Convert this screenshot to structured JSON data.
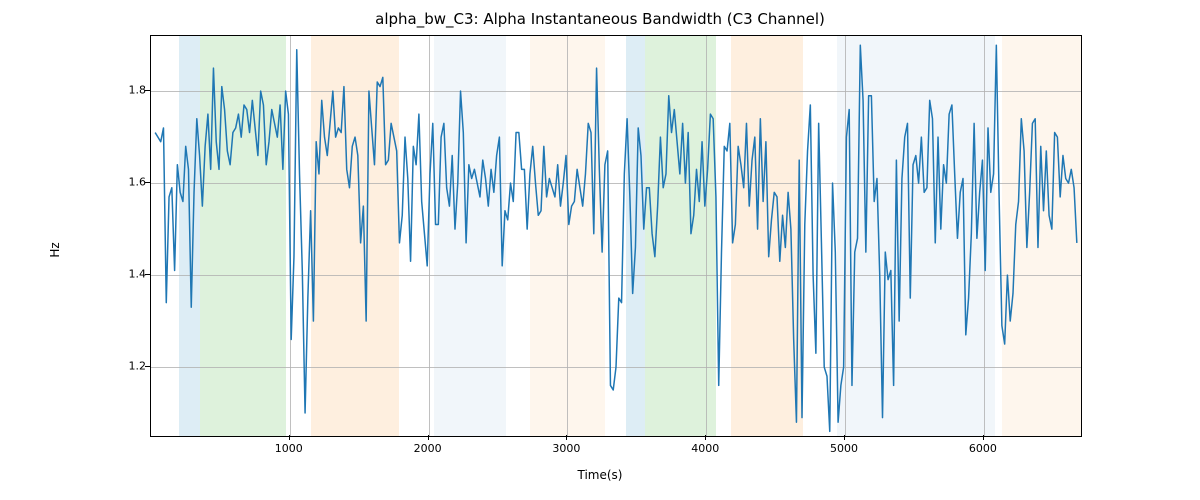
{
  "chart_data": {
    "type": "line",
    "title": "alpha_bw_C3: Alpha Instantaneous Bandwidth (C3 Channel)",
    "xlabel": "Time(s)",
    "ylabel": "Hz",
    "xlim": [
      0,
      6700
    ],
    "ylim": [
      1.05,
      1.92
    ],
    "x_ticks": [
      1000,
      2000,
      3000,
      4000,
      5000,
      6000
    ],
    "y_ticks": [
      1.2,
      1.4,
      1.6,
      1.8
    ],
    "line_color": "#1f77b4",
    "bands": [
      {
        "x0": 200,
        "x1": 350,
        "color": "#9ecae1"
      },
      {
        "x0": 350,
        "x1": 970,
        "color": "#a1d99b"
      },
      {
        "x0": 1150,
        "x1": 1790,
        "color": "#fdd0a2"
      },
      {
        "x0": 2040,
        "x1": 2560,
        "color": "#d6e4f0"
      },
      {
        "x0": 2730,
        "x1": 3270,
        "color": "#fde4cc"
      },
      {
        "x0": 3420,
        "x1": 3560,
        "color": "#9ecae1"
      },
      {
        "x0": 3560,
        "x1": 4070,
        "color": "#a1d99b"
      },
      {
        "x0": 4180,
        "x1": 4700,
        "color": "#fdd0a2"
      },
      {
        "x0": 4940,
        "x1": 6080,
        "color": "#d6e4f0"
      },
      {
        "x0": 6130,
        "x1": 6700,
        "color": "#fde4cc"
      }
    ],
    "series": [
      {
        "name": "alpha_bw_C3",
        "x": [
          30,
          50,
          70,
          90,
          110,
          130,
          150,
          170,
          190,
          210,
          230,
          250,
          270,
          290,
          310,
          330,
          350,
          370,
          390,
          410,
          430,
          450,
          470,
          490,
          510,
          530,
          550,
          570,
          590,
          610,
          630,
          650,
          670,
          690,
          710,
          730,
          750,
          770,
          790,
          810,
          830,
          850,
          870,
          890,
          910,
          930,
          950,
          970,
          990,
          1010,
          1030,
          1050,
          1070,
          1090,
          1110,
          1130,
          1150,
          1170,
          1190,
          1210,
          1230,
          1250,
          1270,
          1290,
          1310,
          1330,
          1350,
          1370,
          1390,
          1410,
          1430,
          1450,
          1470,
          1490,
          1510,
          1530,
          1550,
          1570,
          1590,
          1610,
          1630,
          1650,
          1670,
          1690,
          1710,
          1730,
          1750,
          1770,
          1790,
          1810,
          1830,
          1850,
          1870,
          1890,
          1910,
          1930,
          1950,
          1970,
          1990,
          2010,
          2030,
          2050,
          2070,
          2090,
          2110,
          2130,
          2150,
          2170,
          2190,
          2210,
          2230,
          2250,
          2270,
          2290,
          2310,
          2330,
          2350,
          2370,
          2390,
          2410,
          2430,
          2450,
          2470,
          2490,
          2510,
          2530,
          2550,
          2570,
          2590,
          2610,
          2630,
          2650,
          2670,
          2690,
          2710,
          2730,
          2750,
          2770,
          2790,
          2810,
          2830,
          2850,
          2870,
          2890,
          2910,
          2930,
          2950,
          2970,
          2990,
          3010,
          3030,
          3050,
          3070,
          3090,
          3110,
          3130,
          3150,
          3170,
          3190,
          3210,
          3230,
          3250,
          3270,
          3290,
          3310,
          3330,
          3350,
          3370,
          3390,
          3410,
          3430,
          3450,
          3470,
          3490,
          3510,
          3530,
          3550,
          3570,
          3590,
          3610,
          3630,
          3650,
          3670,
          3690,
          3710,
          3730,
          3750,
          3770,
          3790,
          3810,
          3830,
          3850,
          3870,
          3890,
          3910,
          3930,
          3950,
          3970,
          3990,
          4010,
          4030,
          4050,
          4070,
          4090,
          4110,
          4130,
          4150,
          4170,
          4190,
          4210,
          4230,
          4250,
          4270,
          4290,
          4310,
          4330,
          4350,
          4370,
          4390,
          4410,
          4430,
          4450,
          4470,
          4490,
          4510,
          4530,
          4550,
          4570,
          4590,
          4610,
          4630,
          4650,
          4670,
          4690,
          4710,
          4730,
          4750,
          4770,
          4790,
          4810,
          4830,
          4850,
          4870,
          4890,
          4910,
          4930,
          4950,
          4970,
          4990,
          5010,
          5030,
          5050,
          5070,
          5090,
          5110,
          5130,
          5150,
          5170,
          5190,
          5210,
          5230,
          5250,
          5270,
          5290,
          5310,
          5330,
          5350,
          5370,
          5390,
          5410,
          5430,
          5450,
          5470,
          5490,
          5510,
          5530,
          5550,
          5570,
          5590,
          5610,
          5630,
          5650,
          5670,
          5690,
          5710,
          5730,
          5750,
          5770,
          5790,
          5810,
          5830,
          5850,
          5870,
          5890,
          5910,
          5930,
          5950,
          5970,
          5990,
          6010,
          6030,
          6050,
          6070,
          6090,
          6110,
          6130,
          6150,
          6170,
          6190,
          6210,
          6230,
          6250,
          6270,
          6290,
          6310,
          6330,
          6350,
          6370,
          6390,
          6410,
          6430,
          6450,
          6470,
          6490,
          6510,
          6530,
          6550,
          6570,
          6590,
          6610,
          6630,
          6650,
          6670
        ],
        "y": [
          1.71,
          1.7,
          1.69,
          1.72,
          1.34,
          1.57,
          1.59,
          1.41,
          1.64,
          1.58,
          1.56,
          1.68,
          1.63,
          1.33,
          1.58,
          1.74,
          1.66,
          1.55,
          1.68,
          1.75,
          1.63,
          1.85,
          1.69,
          1.63,
          1.81,
          1.76,
          1.67,
          1.64,
          1.71,
          1.72,
          1.75,
          1.7,
          1.77,
          1.76,
          1.71,
          1.78,
          1.72,
          1.66,
          1.8,
          1.77,
          1.64,
          1.69,
          1.76,
          1.73,
          1.7,
          1.77,
          1.63,
          1.8,
          1.75,
          1.26,
          1.44,
          1.89,
          1.62,
          1.41,
          1.1,
          1.35,
          1.54,
          1.3,
          1.69,
          1.62,
          1.78,
          1.7,
          1.66,
          1.73,
          1.8,
          1.7,
          1.72,
          1.71,
          1.81,
          1.63,
          1.59,
          1.68,
          1.7,
          1.66,
          1.47,
          1.55,
          1.3,
          1.8,
          1.72,
          1.64,
          1.82,
          1.81,
          1.83,
          1.64,
          1.65,
          1.73,
          1.7,
          1.67,
          1.47,
          1.53,
          1.7,
          1.61,
          1.43,
          1.68,
          1.64,
          1.75,
          1.56,
          1.49,
          1.42,
          1.62,
          1.73,
          1.51,
          1.51,
          1.7,
          1.73,
          1.59,
          1.55,
          1.66,
          1.5,
          1.6,
          1.8,
          1.71,
          1.47,
          1.64,
          1.61,
          1.63,
          1.6,
          1.57,
          1.65,
          1.61,
          1.55,
          1.63,
          1.58,
          1.66,
          1.7,
          1.42,
          1.54,
          1.52,
          1.6,
          1.56,
          1.71,
          1.71,
          1.63,
          1.63,
          1.5,
          1.62,
          1.68,
          1.6,
          1.53,
          1.54,
          1.68,
          1.57,
          1.61,
          1.59,
          1.57,
          1.64,
          1.55,
          1.6,
          1.66,
          1.51,
          1.55,
          1.56,
          1.63,
          1.59,
          1.55,
          1.62,
          1.73,
          1.71,
          1.49,
          1.85,
          1.63,
          1.45,
          1.64,
          1.67,
          1.16,
          1.15,
          1.2,
          1.35,
          1.34,
          1.62,
          1.74,
          1.57,
          1.36,
          1.46,
          1.72,
          1.66,
          1.5,
          1.59,
          1.59,
          1.49,
          1.44,
          1.55,
          1.7,
          1.59,
          1.62,
          1.79,
          1.71,
          1.76,
          1.69,
          1.62,
          1.73,
          1.6,
          1.71,
          1.49,
          1.53,
          1.63,
          1.56,
          1.69,
          1.55,
          1.63,
          1.75,
          1.74,
          1.57,
          1.16,
          1.45,
          1.68,
          1.67,
          1.73,
          1.47,
          1.51,
          1.68,
          1.64,
          1.59,
          1.73,
          1.55,
          1.65,
          1.7,
          1.5,
          1.74,
          1.56,
          1.69,
          1.44,
          1.52,
          1.58,
          1.57,
          1.43,
          1.53,
          1.46,
          1.58,
          1.5,
          1.26,
          1.08,
          1.65,
          1.09,
          1.51,
          1.67,
          1.77,
          1.4,
          1.23,
          1.73,
          1.47,
          1.2,
          1.18,
          1.06,
          1.6,
          1.45,
          1.08,
          1.16,
          1.2,
          1.7,
          1.76,
          1.16,
          1.45,
          1.48,
          1.9,
          1.78,
          1.45,
          1.79,
          1.79,
          1.56,
          1.61,
          1.4,
          1.09,
          1.45,
          1.39,
          1.41,
          1.16,
          1.65,
          1.3,
          1.61,
          1.7,
          1.73,
          1.35,
          1.64,
          1.66,
          1.6,
          1.7,
          1.58,
          1.59,
          1.78,
          1.74,
          1.47,
          1.7,
          1.5,
          1.64,
          1.6,
          1.75,
          1.77,
          1.62,
          1.48,
          1.58,
          1.61,
          1.27,
          1.35,
          1.49,
          1.73,
          1.48,
          1.58,
          1.65,
          1.41,
          1.72,
          1.58,
          1.62,
          1.9,
          1.57,
          1.29,
          1.25,
          1.4,
          1.3,
          1.36,
          1.51,
          1.56,
          1.74,
          1.67,
          1.46,
          1.58,
          1.73,
          1.74,
          1.46,
          1.68,
          1.54,
          1.67,
          1.53,
          1.5,
          1.71,
          1.7,
          1.57,
          1.66,
          1.61,
          1.6,
          1.63,
          1.59,
          1.47
        ]
      }
    ]
  }
}
